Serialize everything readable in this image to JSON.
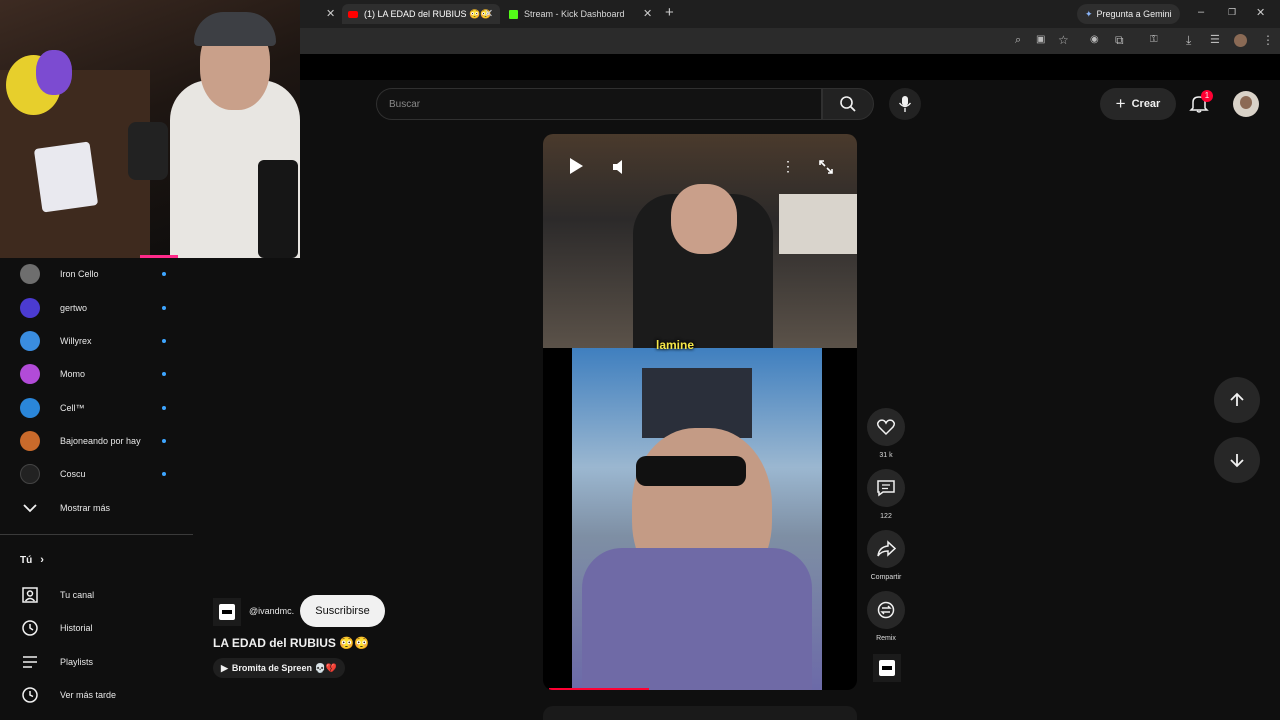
{
  "browser": {
    "tabs": [
      {
        "label": "(1) LA EDAD del RUBIUS 😳😳",
        "active": true
      },
      {
        "label": "Stream - Kick Dashboard",
        "active": false
      }
    ],
    "gemini_label": "Pregunta a Gemini"
  },
  "header": {
    "search_placeholder": "Buscar",
    "create_label": "Crear",
    "notification_count": "1"
  },
  "subscriptions": [
    {
      "name": "Iron Cello",
      "color": "#6e6e6e"
    },
    {
      "name": "gertwo",
      "color": "#4b3bd1"
    },
    {
      "name": "Willyrex",
      "color": "#3a8de0"
    },
    {
      "name": "Momo",
      "color": "#b24bd8"
    },
    {
      "name": "Cell™",
      "color": "#2a86d9"
    },
    {
      "name": "Bajoneando por hay",
      "color": "#c96a2b"
    },
    {
      "name": "Coscu",
      "color": "#222222"
    }
  ],
  "show_more_label": "Mostrar más",
  "you_section": {
    "title": "Tú",
    "items": [
      "Tu canal",
      "Historial",
      "Playlists",
      "Ver más tarde"
    ]
  },
  "short": {
    "caption": "lamine",
    "channel_handle": "@ivandmc.",
    "subscribe_label": "Suscribirse",
    "title": "LA EDAD del RUBIUS 😳😳",
    "suggestion_chip": "Bromita de Spreen 💀💔",
    "likes": "31 k",
    "comments": "122",
    "share_label": "Compartir",
    "remix_label": "Remix",
    "progress": 0.33
  },
  "colors": {
    "accent_red": "#ff0033",
    "dot_blue": "#3ea6ff"
  }
}
